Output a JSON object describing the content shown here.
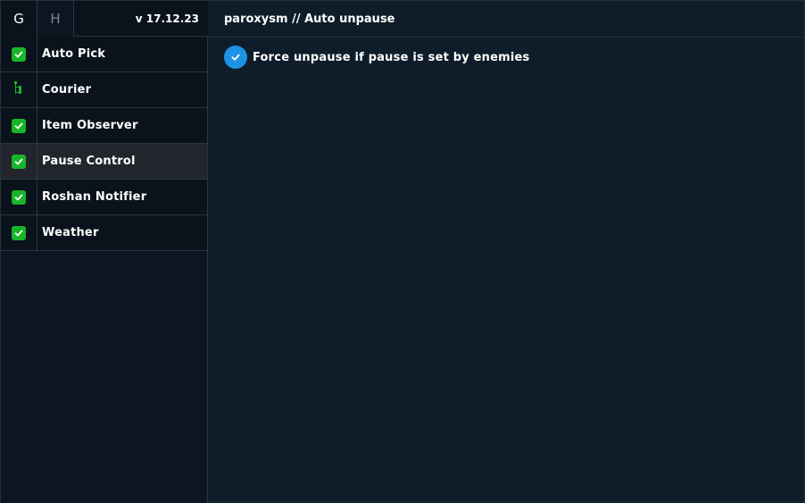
{
  "sidebar": {
    "tabs": [
      {
        "label": "G"
      },
      {
        "label": "H"
      }
    ],
    "version": "v 17.12.23",
    "items": [
      {
        "label": "Auto Pick",
        "icon": "check-icon",
        "enabled": true
      },
      {
        "label": "Courier",
        "icon": "tree-icon",
        "enabled": false
      },
      {
        "label": "Item Observer",
        "icon": "check-icon",
        "enabled": true
      },
      {
        "label": "Pause Control",
        "icon": "check-icon",
        "enabled": true,
        "active": true
      },
      {
        "label": "Roshan Notifier",
        "icon": "check-icon",
        "enabled": true
      },
      {
        "label": "Weather",
        "icon": "check-icon",
        "enabled": true
      }
    ]
  },
  "main": {
    "title": "paroxysm // Auto unpause",
    "options": [
      {
        "label": "Force unpause if pause is set by enemies",
        "checked": true
      }
    ]
  },
  "colors": {
    "background": "#0f1d2b",
    "sidebar": "#0a121b",
    "active_item": "#22262c",
    "check_green": "#18b52b",
    "check_blue": "#1c93e6",
    "border": "#2a3743"
  }
}
